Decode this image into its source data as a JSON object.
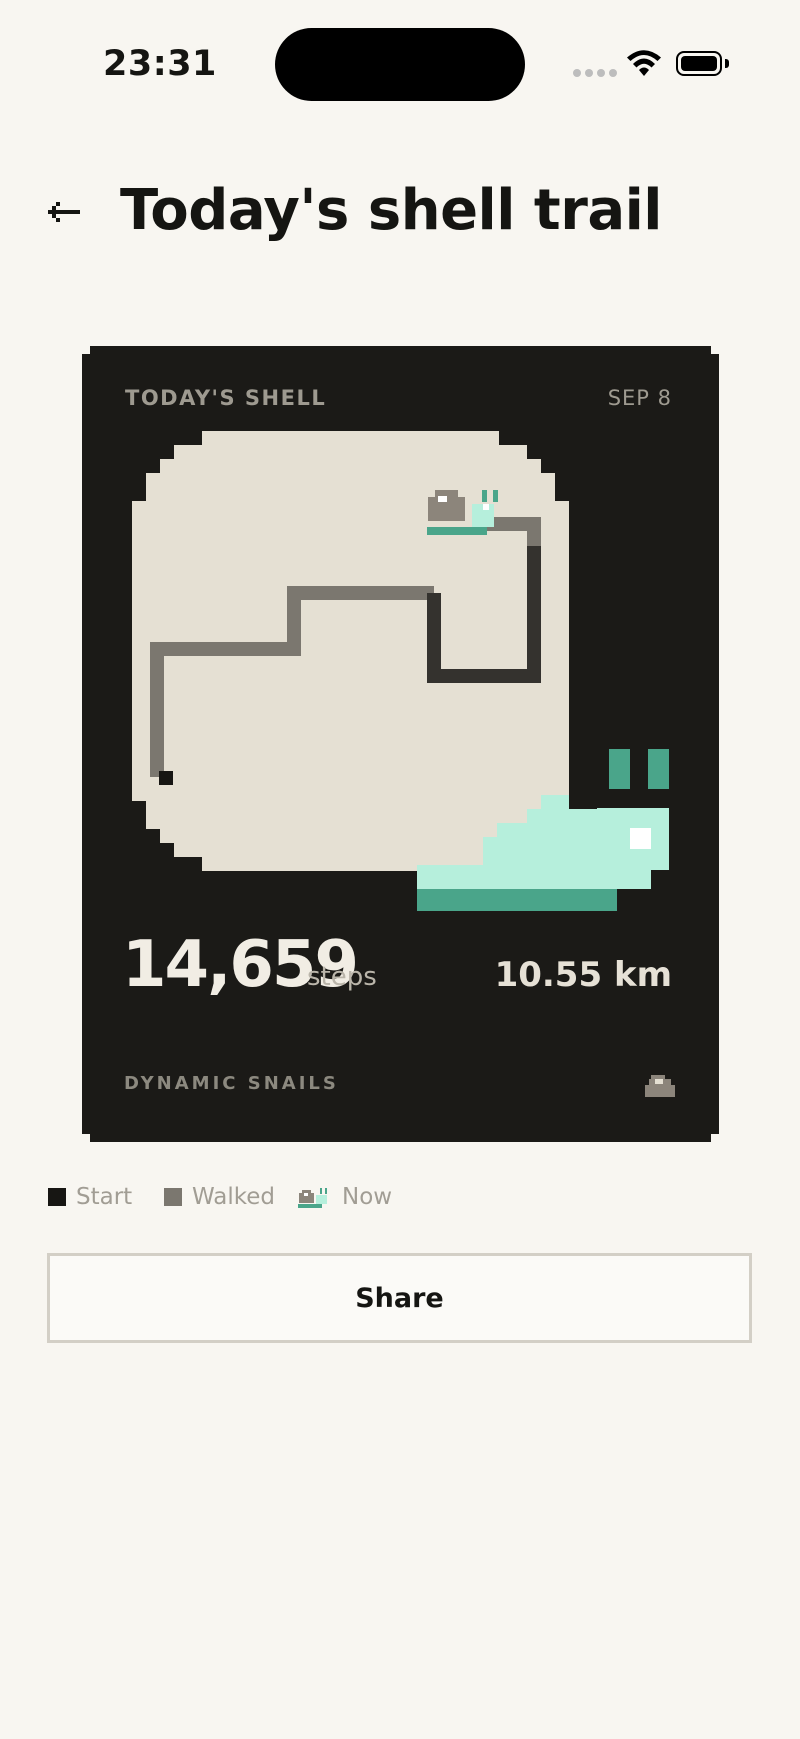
{
  "status_bar": {
    "time": "23:31"
  },
  "header": {
    "title": "Today's shell trail",
    "back_icon": "arrow-left-icon"
  },
  "card": {
    "label": "TODAY'S SHELL",
    "date": "SEP 8",
    "steps": "14,659",
    "steps_unit": "steps",
    "distance": "10.55 km",
    "brand": "DYNAMIC SNAILS",
    "colors": {
      "card_bg": "#1b1a17",
      "map_bg": "#e5e0d3",
      "trail": "#7b776f",
      "start": "#171613",
      "snail_body": "#b6efdc",
      "snail_dark": "#4aa58a",
      "shell": "#8c857b"
    }
  },
  "legend": {
    "start": "Start",
    "walked": "Walked",
    "now": "Now"
  },
  "share_button": {
    "label": "Share"
  }
}
